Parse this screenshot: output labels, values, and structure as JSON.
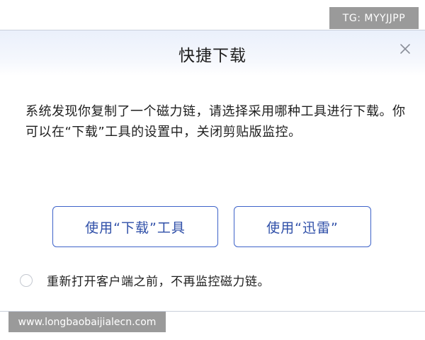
{
  "dialog": {
    "title": "快捷下载",
    "message": "系统发现你复制了一个磁力链，请选择采用哪种工具进行下载。你可以在“下载”工具的设置中，关闭剪贴版监控。",
    "buttons": {
      "download_tool": "使用“下载”工具",
      "xunlei": "使用“迅雷”"
    },
    "checkbox_label": "重新打开客户端之前，不再监控磁力链。",
    "checkbox_checked": false
  },
  "watermarks": {
    "top": "TG: MYYJJPP",
    "bottom": "www.longbaobaijialecn.com"
  },
  "colors": {
    "accent": "#3e63c9",
    "header_gradient": "#eaf0fb",
    "text": "#1f1f1f",
    "watermark_bg": "#9a9a9a"
  },
  "icons": {
    "close": "close-icon"
  }
}
